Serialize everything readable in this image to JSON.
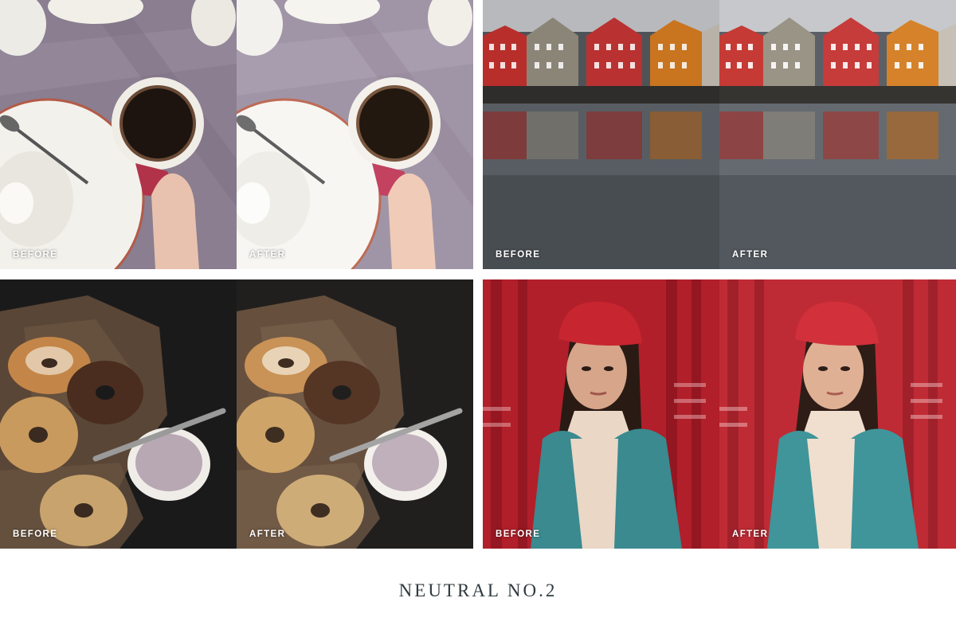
{
  "title": "NEUTRAL NO.2",
  "before_label": "BEFORE",
  "after_label": "AFTER",
  "panels": [
    {
      "subject": "coffee-cup-on-table",
      "before": "BEFORE",
      "after": "AFTER"
    },
    {
      "subject": "red-wooden-houses-on-water",
      "before": "BEFORE",
      "after": "AFTER"
    },
    {
      "subject": "bagels-with-cream-cheese",
      "before": "BEFORE",
      "after": "AFTER"
    },
    {
      "subject": "woman-in-red-beanie-and-denim-jacket",
      "before": "BEFORE",
      "after": "AFTER"
    }
  ],
  "colors": {
    "background": "#ffffff",
    "title": "#2f3a3e",
    "label": "#ffffff"
  }
}
